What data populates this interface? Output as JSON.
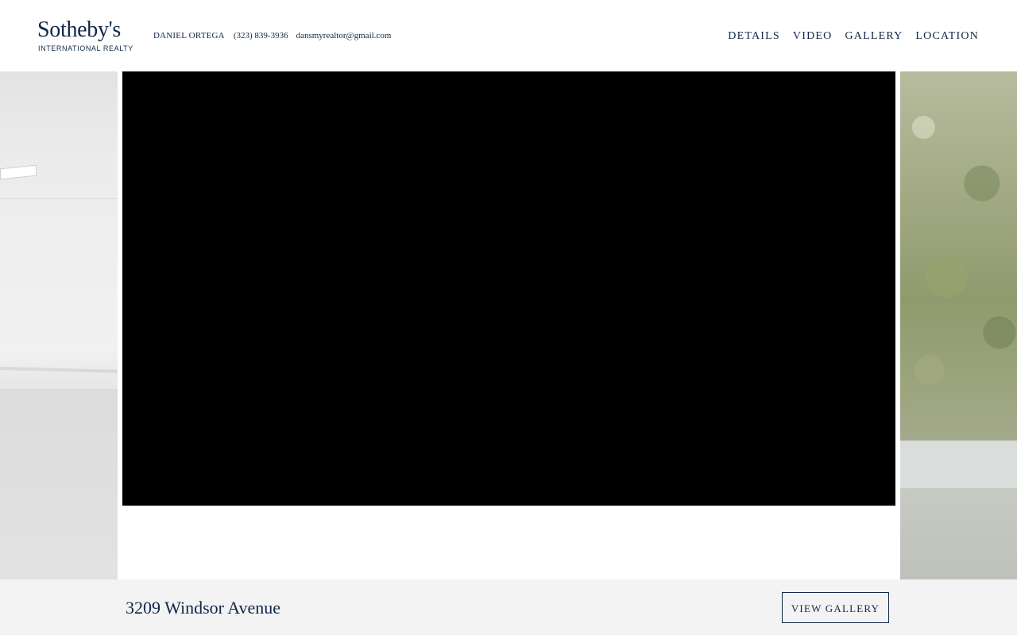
{
  "header": {
    "logo": {
      "name": "Sotheby's",
      "subtitle": "INTERNATIONAL REALTY"
    },
    "agent": {
      "name": "DANIEL ORTEGA",
      "phone": "(323) 839-3936",
      "email": "dansmyrealtor@gmail.com"
    },
    "nav": [
      {
        "label": "DETAILS"
      },
      {
        "label": "VIDEO"
      },
      {
        "label": "GALLERY"
      },
      {
        "label": "LOCATION"
      }
    ]
  },
  "hero": {
    "left_photo": "garage-interior-photo",
    "right_photo": "garden-exterior-photo"
  },
  "footer_bar": {
    "address": "3209 Windsor Avenue",
    "gallery_button": "VIEW GALLERY"
  },
  "colors": {
    "brand_navy": "#0f2746",
    "bar_background": "#f3f3f3",
    "video_background": "#000000"
  }
}
